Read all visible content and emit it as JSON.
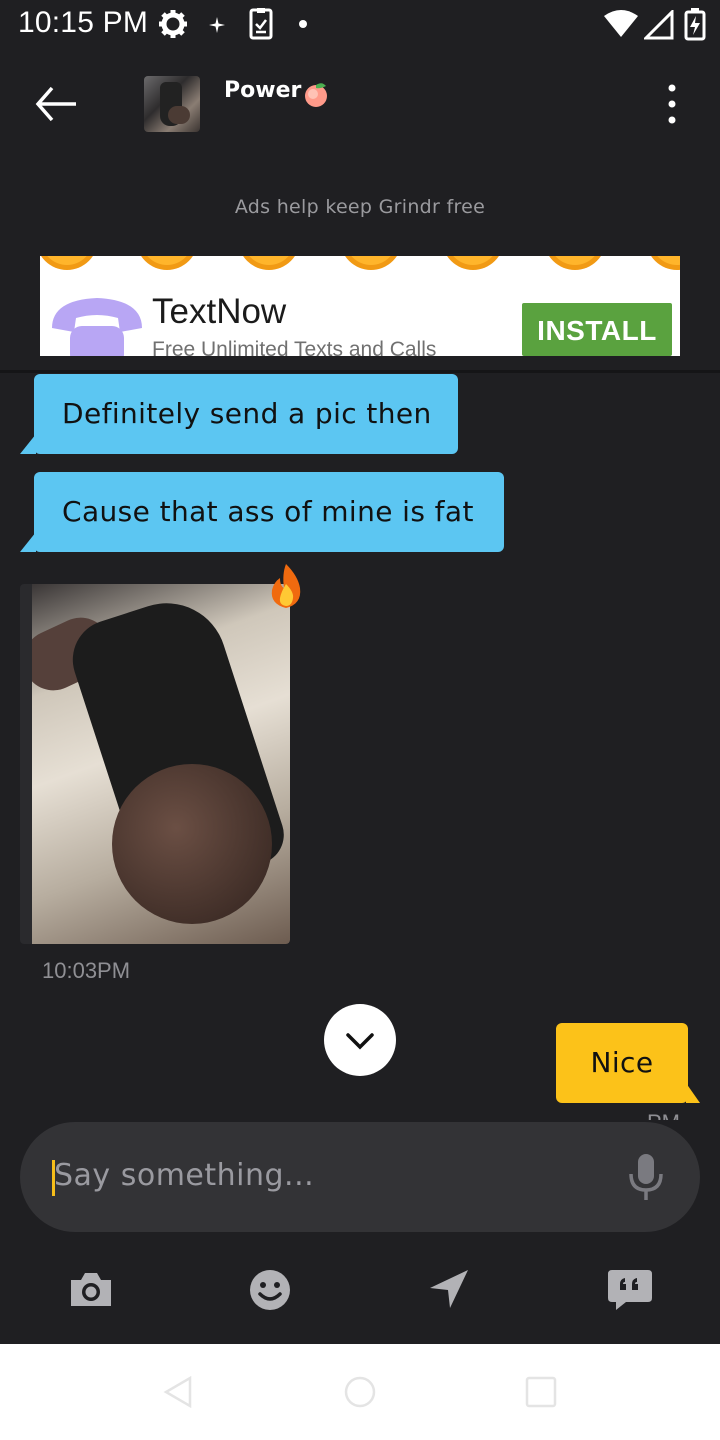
{
  "status_bar": {
    "time": "10:15 PM",
    "icons": [
      "gear-icon",
      "sparkle-icon",
      "device-clipboard-icon",
      "dot-icon",
      "wifi-icon",
      "signal-icon",
      "battery-charging-icon"
    ]
  },
  "header": {
    "back_icon": "arrow-left-icon",
    "profile_name": "Power",
    "name_emoji": "peach-icon",
    "more_icon": "more-vertical-icon"
  },
  "ad": {
    "note": "Ads help keep Grindr free",
    "app_name": "TextNow",
    "tagline": "Free Unlimited Texts and Calls",
    "cta": "INSTALL"
  },
  "messages": {
    "incoming": [
      {
        "text": "Definitely send a pic then"
      },
      {
        "text": "Cause that ass of mine is fat"
      }
    ],
    "photo_reaction": "fire-icon",
    "photo_time": "10:03PM",
    "outgoing": [
      {
        "text": "Nice",
        "time": "PM"
      }
    ]
  },
  "composer": {
    "placeholder": "Say something...",
    "mic_icon": "microphone-icon"
  },
  "toolbar": {
    "items": [
      "camera-icon",
      "emoji-icon",
      "location-arrow-icon",
      "saved-phrases-icon"
    ]
  },
  "nav_bar": {
    "items": [
      "back-triangle-icon",
      "home-circle-icon",
      "recents-square-icon"
    ]
  },
  "colors": {
    "background": "#1f1f22",
    "incoming_bubble": "#5cc6f2",
    "outgoing_bubble": "#fcc219",
    "install_button": "#5aa23f"
  }
}
